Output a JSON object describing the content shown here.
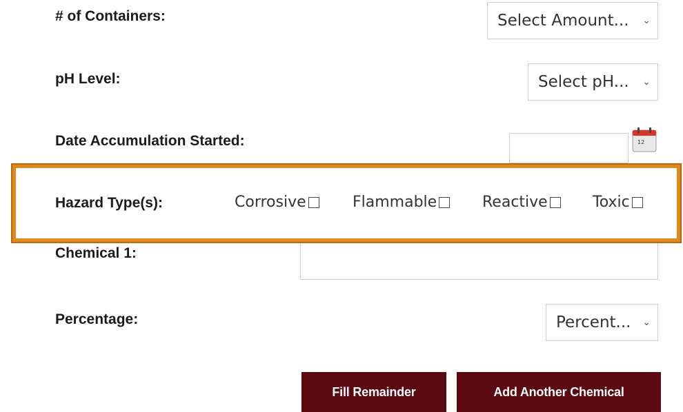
{
  "form": {
    "containers": {
      "label": "# of Containers:",
      "value": "Select Amount..."
    },
    "ph": {
      "label": "pH Level:",
      "value": "Select pH..."
    },
    "date": {
      "label": "Date Accumulation Started:",
      "value": "",
      "calendar_icon": "calendar-icon",
      "calendar_number": "12"
    },
    "hazard": {
      "label": "Hazard Type(s):",
      "options": [
        {
          "label": "Corrosive",
          "checked": false
        },
        {
          "label": "Flammable",
          "checked": false
        },
        {
          "label": "Reactive",
          "checked": false
        },
        {
          "label": "Toxic",
          "checked": false
        }
      ]
    },
    "chemical": {
      "label": "Chemical 1:",
      "value": ""
    },
    "percentage": {
      "label": "Percentage:",
      "value": "Percent..."
    }
  },
  "buttons": {
    "fill_remainder": "Fill Remainder",
    "add_chemical": "Add Another Chemical"
  },
  "colors": {
    "highlight": "#e08a1e",
    "button": "#5c0a12"
  }
}
